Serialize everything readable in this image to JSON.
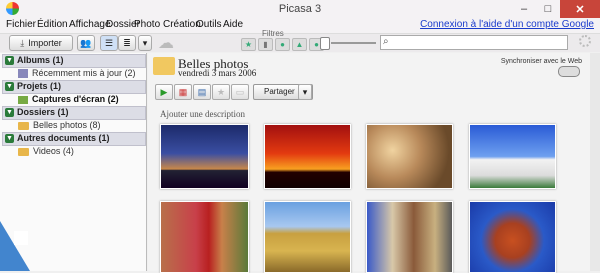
{
  "window": {
    "title": "Picasa 3",
    "minimize": "–",
    "maximize": "□",
    "close": "✕"
  },
  "menu": {
    "items": [
      "Fichier",
      "Édition",
      "Affichage",
      "Dossier",
      "Photo",
      "Création",
      "Outils",
      "Aide"
    ],
    "help_link": "Connexion à l'aide d'un compte Google"
  },
  "toolbar": {
    "import_label": "Importer",
    "filters_label": "Filtres",
    "filter_icons": [
      "star-filter",
      "video-filter",
      "person-filter",
      "face-filter",
      "geo-filter"
    ]
  },
  "sidebar": {
    "sections": [
      {
        "label": "Albums (1)",
        "items": [
          {
            "label": "Récemment mis à jour (2)",
            "icon": "recent"
          }
        ]
      },
      {
        "label": "Projets (1)",
        "items": [
          {
            "label": "Captures d'écran (2)",
            "icon": "screenshot"
          }
        ]
      },
      {
        "label": "Dossiers (1)",
        "items": [
          {
            "label": "Belles photos (8)",
            "icon": "folder"
          }
        ]
      },
      {
        "label": "Autres documents (1)",
        "items": [
          {
            "label": "Videos (4)",
            "icon": "folder"
          }
        ]
      }
    ]
  },
  "main": {
    "folder_title": "Belles photos",
    "folder_date": "vendredi 3 mars 2006",
    "sync_label": "Synchroniser avec le Web",
    "share_label": "Partager",
    "description_placeholder": "Ajouter une description",
    "photos": [
      "city-skyline-dusk",
      "camels-sunset",
      "pharaoh-statues",
      "capitol-building",
      "red-door-adobe",
      "desert-road",
      "timber-houses-street",
      "red-rock-formation"
    ]
  },
  "colors": {
    "accent": "#2a7a3a",
    "link": "#1a3bcc",
    "close": "#c8453a"
  }
}
